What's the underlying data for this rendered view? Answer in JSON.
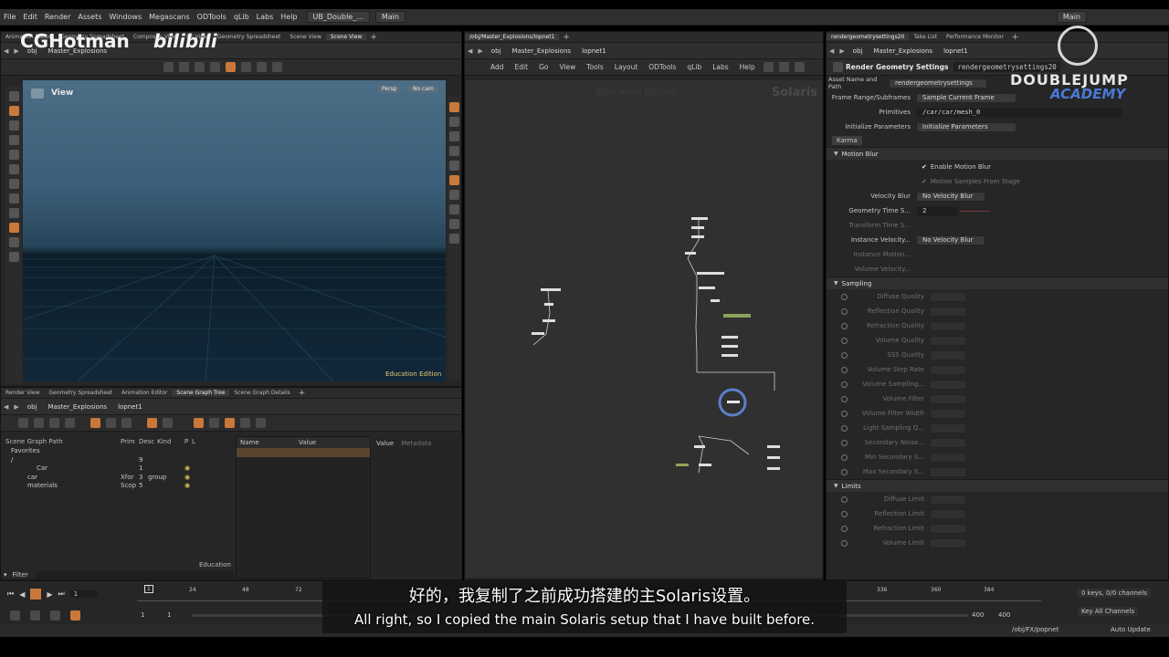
{
  "menubar": {
    "items": [
      "File",
      "Edit",
      "Render",
      "Assets",
      "Windows",
      "Megascans",
      "ODTools",
      "qLib",
      "Labs",
      "Help"
    ],
    "desktop": "UB_Double_...",
    "main": "Main",
    "right_main": "Main"
  },
  "left_top": {
    "tabs": [
      "Animation Editor",
      "Geometry Spreadsheet",
      "Composite View",
      "FX View",
      "Geometry Spreadsheet",
      "Scene View",
      "Scene View"
    ],
    "path": [
      "obj",
      "Master_Explosions"
    ]
  },
  "viewport": {
    "label": "View",
    "persp": "Persp",
    "cam": "No cam",
    "edition": "Education Edition"
  },
  "left_bottom": {
    "tabs": [
      "Render View",
      "Geometry Spreadsheet",
      "Animation Editor",
      "Scene Graph Tree",
      "Scene Graph Details"
    ],
    "path": [
      "obj",
      "Master_Explosions",
      "lopnet1"
    ],
    "columns": [
      "Scene Graph Path",
      "Prim",
      "Desc",
      "Kind",
      "P",
      "L"
    ],
    "rows": [
      {
        "name": "Favorites",
        "prim": "",
        "desc": "",
        "kind": ""
      },
      {
        "name": "/",
        "prim": "",
        "desc": "9",
        "kind": ""
      },
      {
        "name": "Car",
        "prim": "",
        "desc": "1",
        "kind": ""
      },
      {
        "name": "car",
        "prim": "Xfor",
        "desc": "3",
        "kind": "group"
      },
      {
        "name": "materials",
        "prim": "Scop",
        "desc": "5",
        "kind": ""
      }
    ],
    "name_col": "Name",
    "value_col": "Value",
    "value_tab": "Value",
    "metadata_tab": "Metadata",
    "edition": "Education",
    "filter": "Filter"
  },
  "network": {
    "path_tab": "/obj/Master_Explosions/lopnet1",
    "path": [
      "obj",
      "Master_Explosions",
      "lopnet1"
    ],
    "menu": [
      "Add",
      "Edit",
      "Go",
      "View",
      "Tools",
      "Layout",
      "ODTools",
      "qLib",
      "Labs",
      "Help"
    ],
    "edition": "Education Edition",
    "context": "Solaris"
  },
  "params": {
    "tabs": [
      "rendergeometrysettings20",
      "Take List",
      "Performance Monitor"
    ],
    "path": [
      "obj",
      "Master_Explosions",
      "lopnet1"
    ],
    "node_type": "Render Geometry Settings",
    "node_name": "rendergeometrysettings20",
    "asset_label": "Asset Name and Path",
    "asset_value": "rendergeometrysettings",
    "frame_label": "Frame Range/Subframes",
    "frame_value": "Sample Current Frame",
    "prims_label": "Primitives",
    "prims_value": "/car/car/mesh_0",
    "init_label": "Initialize Parameters",
    "init_value": "Initialize Parameters",
    "karma_tab": "Karma",
    "motion_blur": "Motion Blur",
    "enable_mb": "Enable Motion Blur",
    "mb_stage": "Motion Samples From Stage",
    "vel_blur": "Velocity Blur",
    "vel_blur_val": "No Velocity Blur",
    "geo_time": "Geometry Time S...",
    "geo_time_val": "2",
    "xform_time": "Transform Time S...",
    "inst_vel": "Instance Velocity...",
    "inst_vel_val": "No Velocity Blur",
    "inst_motion": "Instance Motion...",
    "vol_vel": "Volume Velocity...",
    "sampling": "Sampling",
    "sampling_rows": [
      "Diffuse Quality",
      "Reflection Quality",
      "Refraction Quality",
      "Volume Quality",
      "SSS Quality",
      "Volume Step Rate",
      "Volume Sampling...",
      "Volume Filter",
      "Volume Filter Width",
      "Light Sampling Q...",
      "Secondary Noise...",
      "Min Secondary S...",
      "Max Secondary S..."
    ],
    "limits": "Limits",
    "limits_rows": [
      "Diffuse Limit",
      "Reflection Limit",
      "Refraction Limit",
      "Volume Limit"
    ]
  },
  "timeline": {
    "frame": "1",
    "ticks": [
      "24",
      "48",
      "72",
      "336",
      "360",
      "384"
    ],
    "start": "1",
    "start2": "1",
    "end": "400",
    "end2": "400",
    "keys": "0 keys, 0/0 channels",
    "key_all": "Key All Channels",
    "path": "/obj/FX/popnet",
    "auto_update": "Auto Update"
  },
  "watermark": {
    "left": "CGHotman",
    "bili": "bilibili",
    "right1": "DOUBLEJUMP",
    "right2": "ACADEMY"
  },
  "subtitle": {
    "zh": "好的，我复制了之前成功搭建的主Solaris设置。",
    "en": "All right, so I copied the main Solaris setup that I have built before."
  }
}
